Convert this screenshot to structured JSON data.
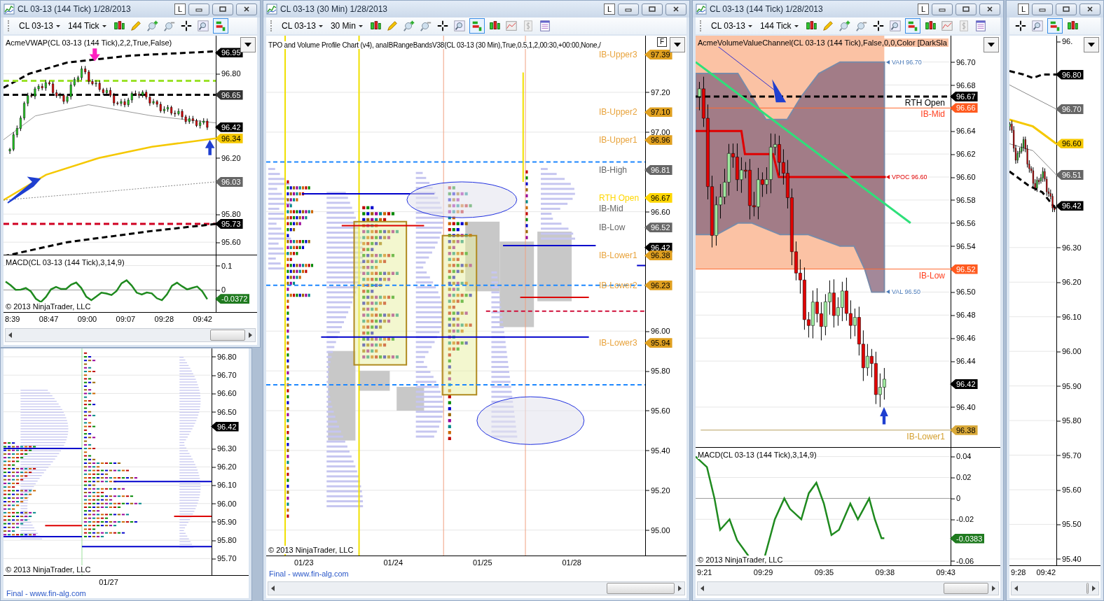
{
  "windows": [
    {
      "kind": "vwap",
      "title": "CL 03-13 (144 Tick)  1/28/2013",
      "lock": "L",
      "instrument": "CL 03-13",
      "interval": "144 Tick",
      "panels": [
        {
          "kind": "vwap",
          "indicator": "AcmeVWAP(CL 03-13 (144 Tick),2,2,True,False)",
          "ticks": [
            "96.80",
            "96.20",
            "95.80",
            "95.60"
          ],
          "tags": [
            {
              "value": "96.95",
              "color": "#000000"
            },
            {
              "value": "96.65",
              "color": "#333333"
            },
            {
              "value": "96.42",
              "color": "#000000"
            },
            {
              "value": "96.34",
              "color": "#f5c800"
            },
            {
              "value": "96.03",
              "color": "#666666"
            },
            {
              "value": "95.73",
              "color": "#000000"
            }
          ]
        },
        {
          "kind": "macd",
          "indicator": "MACD(CL 03-13 (144 Tick),3,14,9)",
          "ticks": [
            "0.1",
            "0"
          ],
          "tags": [
            {
              "value": "-0.0372",
              "color": "#1f7a1f"
            }
          ]
        }
      ],
      "times": [
        "8:39",
        "08:47",
        "09:00",
        "09:07",
        "09:28",
        "09:42"
      ],
      "copyright": "© 2013 NinjaTrader, LLC"
    },
    {
      "kind": "tpo-left",
      "panels": [
        {
          "kind": "tpo-left",
          "ticks": [
            "96.80",
            "96.70",
            "96.60",
            "96.50",
            "96.30",
            "96.20",
            "96.10",
            "96.00",
            "95.90",
            "95.80",
            "95.70"
          ],
          "tags": [
            {
              "value": "96.42",
              "color": "#000000"
            }
          ]
        }
      ],
      "times": [
        "01/27"
      ],
      "copyright": "© 2013 NinjaTrader, LLC",
      "footer": "Final - www.fin-alg.com"
    },
    {
      "kind": "tpo",
      "title": "CL 03-13 (30 Min)  1/28/2013",
      "lock": "L",
      "instrument": "CL 03-13",
      "interval": "30 Min",
      "panels": [
        {
          "kind": "tpo",
          "indicator": "TPO and Volume Profile Chart (v4), anaIBRangeBandsV38(CL 03-13 (30 Min),True,0.5,1,2,00:30,+00:00,None,/",
          "f_button": "F",
          "ticks": [
            "97.20",
            "97.00",
            "96.60",
            "96.00",
            "95.80",
            "95.60",
            "95.40",
            "95.20",
            "95.00"
          ],
          "tags": [
            {
              "value": "97.39",
              "color": "#e0a020",
              "labels": [
                {
                  "text": "IB-Upper3",
                  "color": "#e8a33c"
                }
              ]
            },
            {
              "value": "97.10",
              "color": "#e0a020",
              "labels": [
                {
                  "text": "IB-Upper2",
                  "color": "#e8a33c"
                }
              ]
            },
            {
              "value": "96.96",
              "color": "#e0a020",
              "labels": [
                {
                  "text": "IB-Upper1",
                  "color": "#e8a33c"
                }
              ]
            },
            {
              "value": "96.81",
              "color": "#666666",
              "labels": [
                {
                  "text": "IB-High",
                  "color": "#666666"
                }
              ]
            },
            {
              "value": "96.67",
              "color": "#ffd700",
              "labels": [
                {
                  "text": "RTH Open",
                  "color": "#ffd700"
                },
                {
                  "text": "IB-Mid",
                  "color": "#666666"
                }
              ]
            },
            {
              "value": "96.52",
              "color": "#666666",
              "labels": [
                {
                  "text": "IB-Low",
                  "color": "#666666"
                }
              ]
            },
            {
              "value": "96.42",
              "color": "#000000"
            },
            {
              "value": "96.38",
              "color": "#e0a020",
              "labels": [
                {
                  "text": "IB-Lower1",
                  "color": "#e8a33c"
                }
              ]
            },
            {
              "value": "96.23",
              "color": "#e0a020",
              "labels": [
                {
                  "text": "IB-Lower2",
                  "color": "#e8a33c"
                }
              ]
            },
            {
              "value": "95.94",
              "color": "#e0a020",
              "labels": [
                {
                  "text": "IB-Lower3",
                  "color": "#e8a33c"
                }
              ]
            }
          ]
        }
      ],
      "times": [
        "01/23",
        "01/24",
        "01/25",
        "01/28"
      ],
      "copyright": "© 2013 NinjaTrader, LLC",
      "footer": "Final - www.fin-alg.com"
    },
    {
      "kind": "channel",
      "title": "CL 03-13 (144 Tick)  1/28/2013",
      "lock": "L",
      "instrument": "CL 03-13",
      "interval": "144 Tick",
      "panels": [
        {
          "kind": "channel",
          "indicator": "AcmeVolumeValueChannel(CL 03-13 (144 Tick),False,0,0,Color [DarkSla",
          "ticks": [
            "96.70",
            "96.68",
            "96.64",
            "96.62",
            "96.60",
            "96.58",
            "96.56",
            "96.54",
            "96.50",
            "96.48",
            "96.46",
            "96.44",
            "96.40"
          ],
          "tags": [
            {
              "value": "96.67",
              "color": "#000000",
              "labels": [
                {
                  "text": "RTH Open",
                  "color": "#000000"
                }
              ]
            },
            {
              "value": "96.66",
              "color": "#ff5a1f",
              "labels": [
                {
                  "text": "IB-Mid",
                  "color": "#ff4020"
                }
              ]
            },
            {
              "value": "96.52",
              "color": "#ff5a1f",
              "labels": [
                {
                  "text": "IB-Low",
                  "color": "#ff4020"
                }
              ]
            },
            {
              "value": "96.42",
              "color": "#000000"
            },
            {
              "value": "96.38",
              "color": "#d8a838",
              "labels": [
                {
                  "text": "IB-Lower1",
                  "color": "#d4a030"
                }
              ]
            }
          ],
          "markers": [
            {
              "text": "VAH 96.70",
              "color": "#4a7ab8"
            },
            {
              "text": "VPOC 96.60",
              "color": "#e00000"
            },
            {
              "text": "VAL 96.50",
              "color": "#4a7ab8"
            }
          ]
        },
        {
          "kind": "macd",
          "indicator": "MACD(CL 03-13 (144 Tick),3,14,9)",
          "ticks": [
            "0.04",
            "0.02",
            "0",
            "-0.02",
            "-0.06"
          ],
          "tags": [
            {
              "value": "-0.0383",
              "color": "#1f7a1f"
            }
          ]
        }
      ],
      "times": [
        "9:21",
        "09:29",
        "09:35",
        "09:38",
        "09:43"
      ],
      "copyright": "© 2013 NinjaTrader, LLC"
    },
    {
      "kind": "vwap-cut",
      "lock": "L",
      "panels": [
        {
          "kind": "vwap-cut",
          "partial_tick": "96.",
          "ticks": [
            "96.30",
            "96.20",
            "96.10",
            "96.00",
            "95.90",
            "95.80",
            "95.70",
            "95.60",
            "95.50",
            "95.40"
          ],
          "tags": [
            {
              "value": "96.80",
              "color": "#000000"
            },
            {
              "value": "96.70",
              "color": "#666666"
            },
            {
              "value": "96.60",
              "color": "#f5c800"
            },
            {
              "value": "96.51",
              "color": "#666666"
            },
            {
              "value": "96.42",
              "color": "#000000"
            }
          ]
        }
      ],
      "times": [
        "9:28",
        "09:42"
      ]
    }
  ]
}
